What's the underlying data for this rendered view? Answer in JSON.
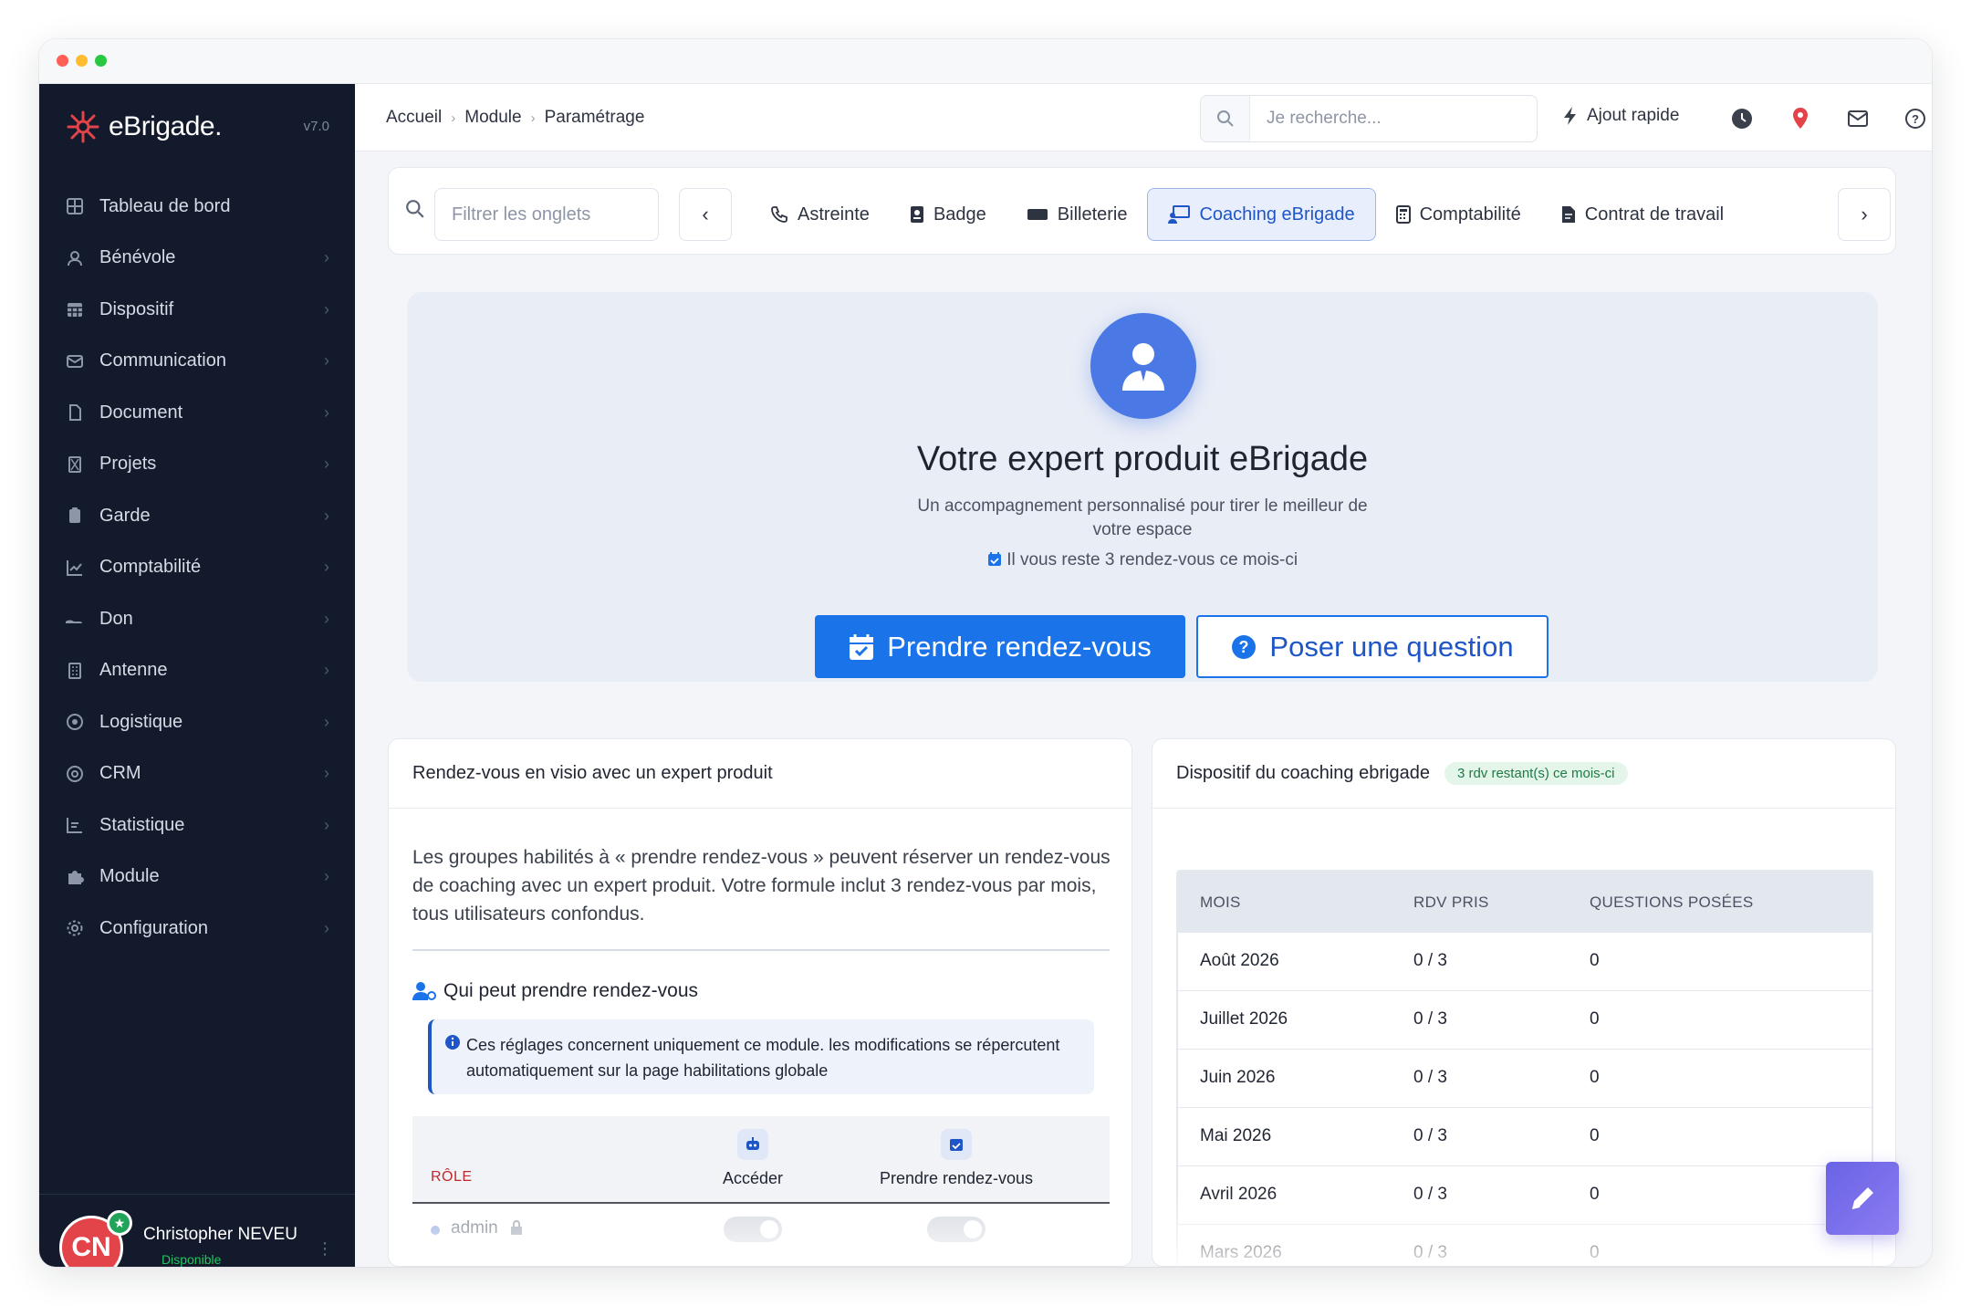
{
  "sidebar": {
    "logo_text": "eBrigade.",
    "version": "v7.0",
    "items": [
      {
        "label": "Tableau de bord",
        "icon": "dashboard-icon"
      },
      {
        "label": "Bénévole",
        "icon": "user-icon"
      },
      {
        "label": "Dispositif",
        "icon": "calendar-grid-icon"
      },
      {
        "label": "Communication",
        "icon": "mail-icon"
      },
      {
        "label": "Document",
        "icon": "file-icon"
      },
      {
        "label": "Projets",
        "icon": "hourglass-icon"
      },
      {
        "label": "Garde",
        "icon": "clipboard-icon"
      },
      {
        "label": "Comptabilité",
        "icon": "line-chart-icon"
      },
      {
        "label": "Don",
        "icon": "hand-icon"
      },
      {
        "label": "Antenne",
        "icon": "building-icon"
      },
      {
        "label": "Logistique",
        "icon": "circle-dot-icon"
      },
      {
        "label": "CRM",
        "icon": "at-icon"
      },
      {
        "label": "Statistique",
        "icon": "bar-chart-icon"
      },
      {
        "label": "Module",
        "icon": "puzzle-icon"
      },
      {
        "label": "Configuration",
        "icon": "gear-icon"
      }
    ],
    "user": {
      "initials": "CN",
      "name": "Christopher NEVEU",
      "status": "Disponible"
    }
  },
  "header": {
    "breadcrumb": [
      "Accueil",
      "Module",
      "Paramétrage"
    ],
    "search_placeholder": "Je recherche...",
    "quick_add": "Ajout rapide"
  },
  "tabsbar": {
    "filter_placeholder": "Filtrer les onglets",
    "tabs": [
      {
        "label": "Astreinte",
        "icon": "phone-icon"
      },
      {
        "label": "Badge",
        "icon": "badge-icon"
      },
      {
        "label": "Billeterie",
        "icon": "ticket-icon"
      },
      {
        "label": "Coaching eBrigade",
        "icon": "chalkboard-user-icon",
        "active": true
      },
      {
        "label": "Comptabilité",
        "icon": "calculator-icon"
      },
      {
        "label": "Contrat de travail",
        "icon": "file-contract-icon"
      }
    ]
  },
  "hero": {
    "title": "Votre expert produit eBrigade",
    "subtitle": "Un accompagnement personnalisé pour tirer le meilleur de votre espace",
    "remaining": "Il vous reste 3 rendez-vous ce mois-ci",
    "primary_button": "Prendre rendez-vous",
    "secondary_button": "Poser une question"
  },
  "left_card": {
    "title": "Rendez-vous en visio avec un expert produit",
    "description": "Les groupes habilités à « prendre rendez-vous » peuvent réserver un rendez-vous de coaching avec un expert produit. Votre formule inclut 3 rendez-vous par mois, tous utilisateurs confondus.",
    "who_title": "Qui peut prendre rendez-vous",
    "note": "Ces réglages concernent uniquement ce module. les modifications se répercutent automatiquement sur la page habilitations globale",
    "role_header": "RÔLE",
    "col_access": "Accéder",
    "col_book": "Prendre rendez-vous",
    "roles": [
      {
        "name": "admin"
      }
    ]
  },
  "right_card": {
    "title": "Dispositif du coaching ebrigade",
    "badge": "3 rdv restant(s) ce mois-ci",
    "columns": [
      "MOIS",
      "RDV PRIS",
      "QUESTIONS POSÉES"
    ],
    "rows": [
      {
        "month": "Août 2026",
        "rdv": "0 / 3",
        "questions": "0"
      },
      {
        "month": "Juillet 2026",
        "rdv": "0 / 3",
        "questions": "0"
      },
      {
        "month": "Juin 2026",
        "rdv": "0 / 3",
        "questions": "0"
      },
      {
        "month": "Mai 2026",
        "rdv": "0 / 3",
        "questions": "0"
      },
      {
        "month": "Avril 2026",
        "rdv": "0 / 3",
        "questions": "0"
      },
      {
        "month": "Mars 2026",
        "rdv": "0 / 3",
        "questions": "0"
      }
    ]
  },
  "colors": {
    "sidebar_bg": "#121a2c",
    "accent": "#1a73e8",
    "brand": "#e2444a",
    "success": "#22a35a"
  }
}
